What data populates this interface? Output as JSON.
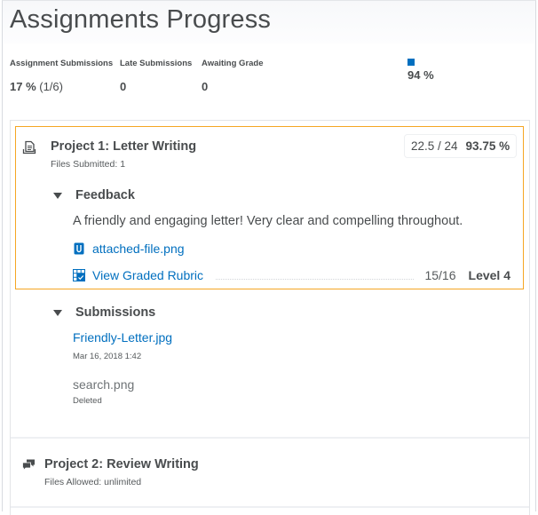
{
  "page": {
    "title": "Assignments Progress"
  },
  "summary": {
    "stats": [
      {
        "label": "Assignment Submissions",
        "value_bold": "17 %",
        "value_rest": " (1/6)"
      },
      {
        "label": "Late Submissions",
        "value_bold": "0",
        "value_rest": ""
      },
      {
        "label": "Awaiting Grade",
        "value_bold": "0",
        "value_rest": ""
      }
    ],
    "average_grade": {
      "value": "94 %",
      "color": "#006fbf"
    }
  },
  "assignments": [
    {
      "icon": "document-submission-icon",
      "title": "Project 1: Letter Writing",
      "subtitle": "Files Submitted: 1",
      "score": "22.5 / 24",
      "percent": "93.75 %",
      "feedback": {
        "heading": "Feedback",
        "text": "A friendly and engaging letter! Very clear and compelling throughout.",
        "attachment": "attached-file.png",
        "rubric_link": "View Graded Rubric",
        "rubric_score": "15/16",
        "rubric_level": "Level 4"
      },
      "submissions": {
        "heading": "Submissions",
        "files": [
          {
            "name": "Friendly-Letter.jpg",
            "meta": "Mar 16, 2018 1:42",
            "deleted": false
          },
          {
            "name": "search.png",
            "meta": "Deleted",
            "deleted": true
          }
        ]
      }
    },
    {
      "icon": "discussion-icon",
      "title": "Project 2: Review Writing",
      "subtitle": "Files Allowed: unlimited"
    }
  ],
  "colors": {
    "link": "#006fbf",
    "focus": "#f5a623",
    "text": "#494c4e"
  }
}
